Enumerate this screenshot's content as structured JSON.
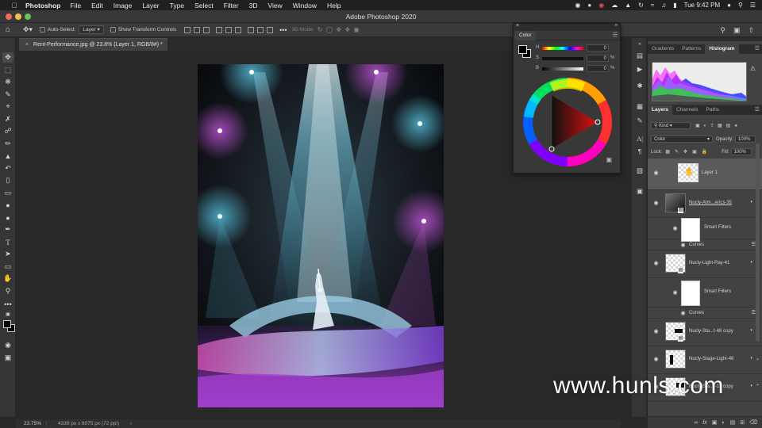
{
  "menubar": {
    "app_name": "Photoshop",
    "items": [
      "File",
      "Edit",
      "Image",
      "Layer",
      "Type",
      "Select",
      "Filter",
      "3D",
      "View",
      "Window",
      "Help"
    ],
    "clock": "Tue 9:42 PM"
  },
  "titlebar": {
    "title": "Adobe Photoshop 2020"
  },
  "options": {
    "auto_select_label": "Auto-Select:",
    "auto_select_value": "Layer",
    "show_transform_label": "Show Transform Controls",
    "mode_3d_label": "3D Mode:"
  },
  "document": {
    "tab_label": "Rent-Performance.jpg @ 23.8% (Layer 1, RGB/8#) *"
  },
  "status": {
    "zoom": "23.75%",
    "info": "4339 px x 6075 px (72 ppi)"
  },
  "color_panel": {
    "tab": "Color",
    "sliders": [
      {
        "label": "H",
        "value": "0",
        "unit": ""
      },
      {
        "label": "S",
        "value": "0",
        "unit": "%"
      },
      {
        "label": "B",
        "value": "0",
        "unit": "%"
      }
    ]
  },
  "top_panel": {
    "tabs": [
      "Gradients",
      "Patterns",
      "Histogram"
    ],
    "active_tab": "Histogram"
  },
  "layers_panel": {
    "tabs": [
      "Layers",
      "Channels",
      "Paths"
    ],
    "active_tab": "Layers",
    "kind_label": "Kind",
    "blend_mode": "Color",
    "opacity_label": "Opacity:",
    "opacity_value": "100%",
    "lock_label": "Lock:",
    "fill_label": "Fill:",
    "fill_value": "100%",
    "layers": [
      {
        "name": "Layer 1"
      },
      {
        "name": "Nucly-Atm...erics-35"
      },
      {
        "name": "Smart Filters"
      },
      {
        "name": "Curves"
      },
      {
        "name": "Nucly-Light-Ray-41"
      },
      {
        "name": "Smart Filters"
      },
      {
        "name": "Curves"
      },
      {
        "name": "Nucly-Sta...t-48 copy"
      },
      {
        "name": "Nucly-Stage-Light-48"
      },
      {
        "name": "Nucly-Sta...t-15 copy"
      }
    ]
  },
  "watermark": "www.hunls.com",
  "colors": {
    "accent_red": "#ec6a5e",
    "accent_yellow": "#f4bf4f",
    "accent_green": "#61c554",
    "beam_cyan": "#5ecbe6",
    "light_magenta": "#c04ad8"
  }
}
